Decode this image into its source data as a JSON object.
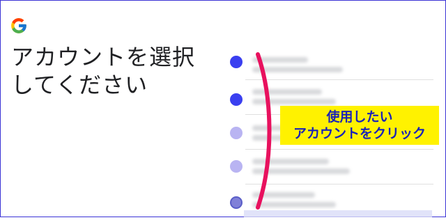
{
  "header": {
    "logo_icon": "google-g-icon",
    "title_line1": "アカウントを選択",
    "title_line2": "してください"
  },
  "accounts": [
    {
      "avatar_color": "#3a3ff0"
    },
    {
      "avatar_color": "#3a3ff0"
    },
    {
      "avatar_color": "#b9b4f2"
    },
    {
      "avatar_color": "#b9b4f2"
    },
    {
      "avatar_color": "#8080d8"
    }
  ],
  "annotation": {
    "line1": "使用したい",
    "line2": "アカウントをクリック",
    "bracket_color": "#e8115e",
    "background_color": "#fff200",
    "text_color": "#1a23b8"
  },
  "colors": {
    "frame_border": "#3b33d6",
    "title_text": "#202124"
  }
}
